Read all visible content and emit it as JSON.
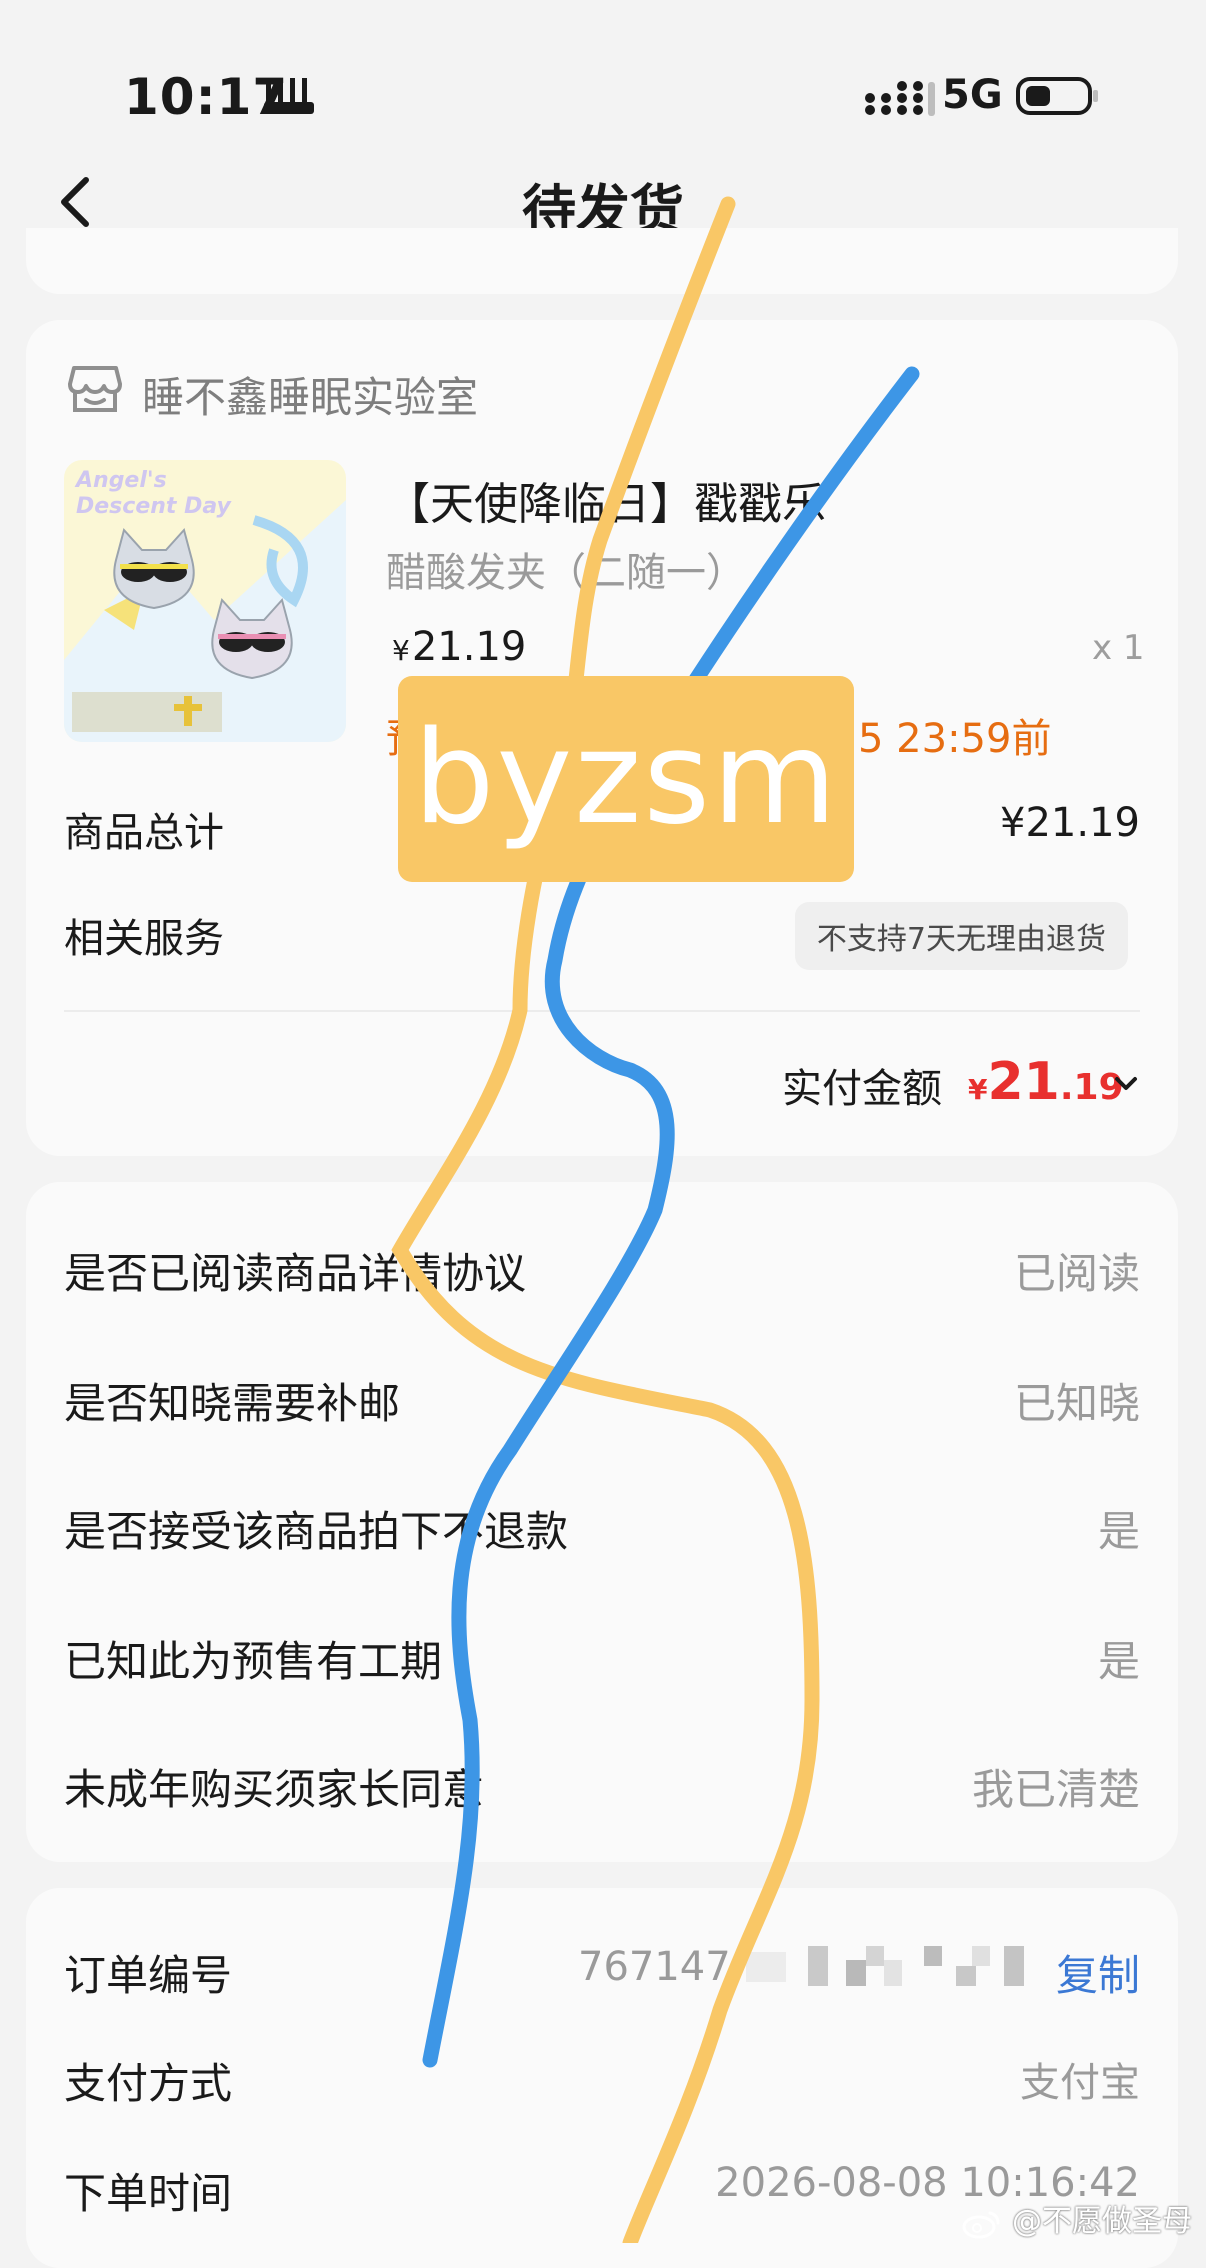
{
  "status_bar": {
    "time": "10:17",
    "network": "5G"
  },
  "header": {
    "title": "待发货"
  },
  "store": {
    "name": "睡不鑫睡眠实验室"
  },
  "product": {
    "title": "【天使降临日】戳戳乐",
    "variant": "醋酸发夹（二随一）",
    "price_symbol": "¥",
    "price": "21.19",
    "quantity": "x 1",
    "shipping_left": "预",
    "shipping_right": "5 23:59前",
    "thumbnail_text": "Angel's Descent Day"
  },
  "summary": {
    "goods_total_label": "商品总计",
    "goods_total_value": "¥21.19",
    "service_label": "相关服务",
    "service_tag": "不支持7天无理由退货",
    "paid_label": "实付金额",
    "paid_symbol": "¥",
    "paid_int": "21",
    "paid_dec": ".19"
  },
  "questions": [
    {
      "label": "是否已阅读商品详情协议",
      "value": "已阅读"
    },
    {
      "label": "是否知晓需要补邮",
      "value": "已知晓"
    },
    {
      "label": "是否接受该商品拍下不退款",
      "value": "是"
    },
    {
      "label": "已知此为预售有工期",
      "value": "是"
    },
    {
      "label": "未成年购买须家长同意",
      "value": "我已清楚"
    }
  ],
  "order": {
    "number_label": "订单编号",
    "number_value": "767147",
    "copy_label": "复制",
    "payment_label": "支付方式",
    "payment_value": "支付宝",
    "time_label": "下单时间",
    "time_value": "2026-08-08 10:16:42"
  },
  "watermarks": {
    "center_text": "byzsm",
    "weibo_text": "@不愿做圣母"
  },
  "colors": {
    "accent_orange": "#e66d11",
    "price_red": "#e8302e",
    "link_blue": "#3b78d4",
    "line_yellow": "#f9c766",
    "line_blue": "#3d96e6"
  }
}
